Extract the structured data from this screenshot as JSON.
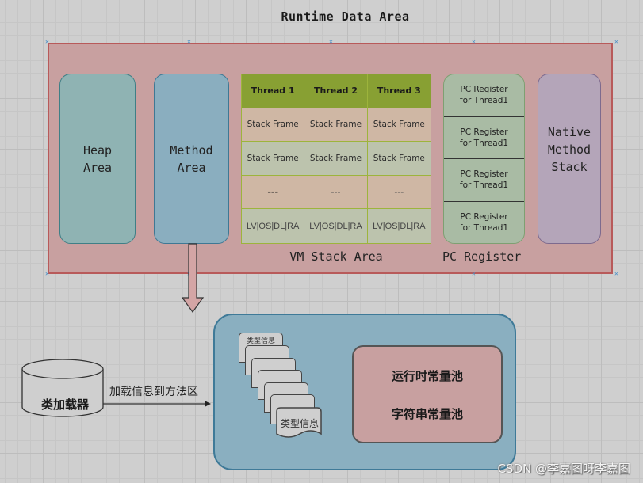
{
  "title": "Runtime Data Area",
  "runtime_data_area": {
    "heap": {
      "label": "Heap\nArea",
      "color": "#8fb3b3"
    },
    "method": {
      "label": "Method\nArea",
      "color": "#8aaebf"
    },
    "vm_stack": {
      "label": "VM Stack Area",
      "threads": [
        "Thread 1",
        "Thread 2",
        "Thread 3"
      ],
      "rows": [
        [
          "Stack Frame",
          "Stack Frame",
          "Stack Frame"
        ],
        [
          "Stack Frame",
          "Stack Frame",
          "Stack Frame"
        ],
        [
          "---",
          "---",
          "---"
        ],
        [
          "LV|OS|DL|RA",
          "LV|OS|DL|RA",
          "LV|OS|DL|RA"
        ]
      ],
      "header_color": "#88a033"
    },
    "pc_register": {
      "label": "PC Register",
      "items": [
        "PC Register\nfor  Thread1",
        "PC Register\nfor  Thread1",
        "PC Register\nfor  Thread1",
        "PC Register\nfor  Thread1"
      ],
      "color": "#a9bba4"
    },
    "native": {
      "label": "Native\nMethod\nStack",
      "color": "#b4a5b9"
    },
    "border_color": "#b85a5a",
    "fill_color": "#c8a0a0"
  },
  "class_loader": {
    "label": "类加载器",
    "edge_label": "加载信息到方法区"
  },
  "method_area_detail": {
    "type_info_top": "类型信息",
    "type_info_bottom": "类型信息",
    "pools": [
      "运行时常量池",
      "字符串常量池"
    ]
  },
  "watermark": "CSDN @李嘉图呀李嘉图"
}
